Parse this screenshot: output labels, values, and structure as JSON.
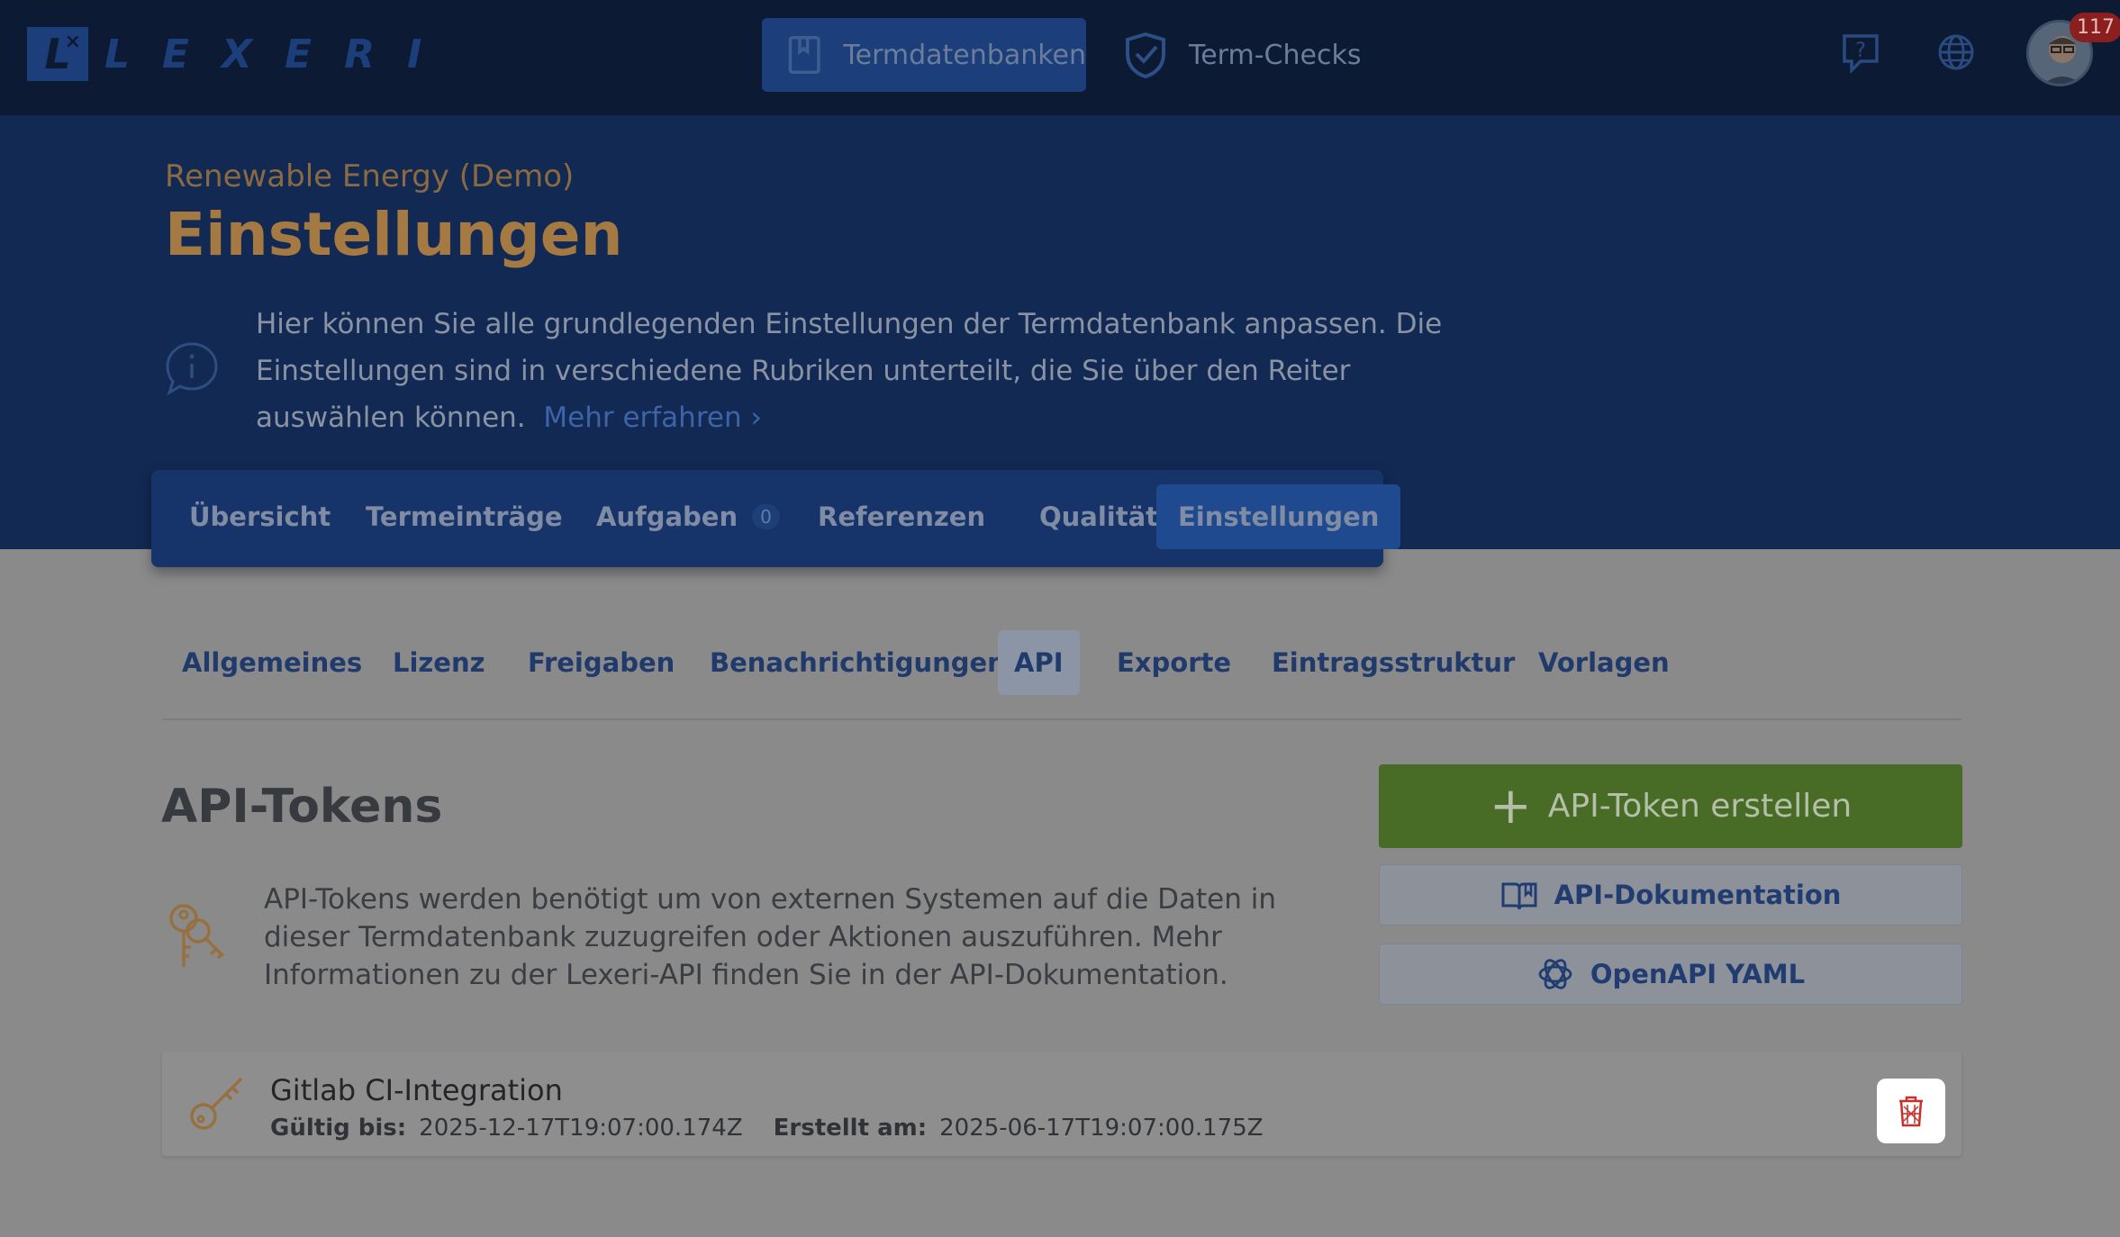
{
  "topbar": {
    "logo_mark": "L",
    "logo_text": "LEXERI",
    "nav": [
      {
        "label": "Termdatenbanken",
        "active": true,
        "icon": "book-icon"
      },
      {
        "label": "Term-Checks",
        "active": false,
        "icon": "shield-check-icon"
      }
    ],
    "notification_count": "117"
  },
  "header": {
    "project": "Renewable Energy (Demo)",
    "title": "Einstellungen",
    "info_text": "Hier können Sie alle grundlegenden Einstellungen der Termdatenbank anpassen. Die Einstellungen sind in verschiedene Rubriken unterteilt, die Sie über den Reiter auswählen können.",
    "more_link": "Mehr erfahren",
    "more_chevron": "›"
  },
  "tabs": {
    "overview": "Übersicht",
    "entries": "Termeinträge",
    "tasks": "Aufgaben",
    "tasks_count": "0",
    "references": "Referenzen",
    "quality": "Qualität",
    "settings": "Einstellungen"
  },
  "subtabs": {
    "general": "Allgemeines",
    "license": "Lizenz",
    "sharing": "Freigaben",
    "notifications": "Benachrichtigungen",
    "api": "API",
    "exports": "Exporte",
    "structure": "Eintragsstruktur",
    "templates": "Vorlagen"
  },
  "api": {
    "title": "API-Tokens",
    "description": "API-Tokens werden benötigt um von externen Systemen auf die Daten in dieser Termdatenbank zuzugreifen oder Aktionen auszuführen. Mehr Informationen zu der Lexeri-API finden Sie in der API-Dokumentation.",
    "create_label": "API-Token erstellen",
    "doc_label": "API-Dokumentation",
    "yaml_label": "OpenAPI YAML",
    "tokens": [
      {
        "name": "Gitlab CI-Integration",
        "valid_label": "Gültig bis:",
        "valid_value": "2025-12-17T19:07:00.174Z",
        "created_label": "Erstellt am:",
        "created_value": "2025-06-17T19:07:00.175Z"
      }
    ]
  },
  "colors": {
    "topbar": "#0c1a33",
    "band": "#122953",
    "accent": "#1f4a90",
    "create": "#486b26",
    "title": "#a47a42"
  }
}
